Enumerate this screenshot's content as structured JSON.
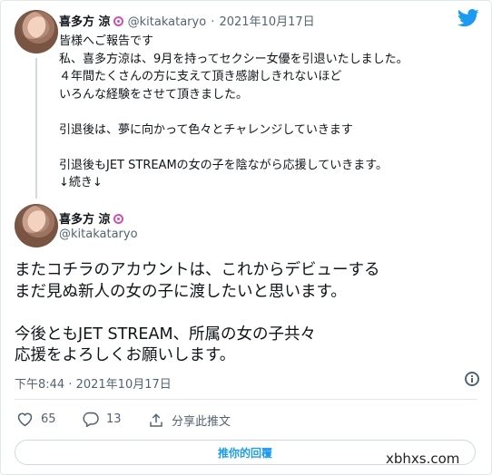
{
  "tweet1": {
    "display_name": "喜多方 涼",
    "handle": "@kitakataryo",
    "separator": "·",
    "date": "2021年10月17日",
    "text": "皆様へご報告です\n私、喜多方涼は、9月を持ってセクシー女優を引退いたしました。\n４年間たくさんの方に支えて頂き感謝しきれないほど\nいろんな経験をさせて頂きました。\n\n引退後は、夢に向かって色々とチャレンジしていきます\n\n引退後もJET STREAMの女の子を陰ながら応援していきます。\n↓続き↓"
  },
  "tweet2": {
    "display_name": "喜多方 涼",
    "handle": "@kitakataryo",
    "text": "またコチラのアカウントは、これからデビューする\nまだ見ぬ新人の女の子に渡したいと思います。\n\n今後ともJET STREAM、所属の女の子共々\n応援をよろしくお願いします。",
    "timestamp": "下午8:44 · 2021年10月17日"
  },
  "actions": {
    "likes": "65",
    "replies": "13",
    "share_label": "分享此推文"
  },
  "reply_button": "推你的回覆",
  "watermark": "xbhxs.com",
  "icons": {
    "logo": "twitter-bird-icon",
    "info": "info-icon",
    "like": "heart-icon",
    "reply": "comment-icon",
    "share": "share-icon",
    "badge": "verified-style-badge-icon"
  },
  "colors": {
    "accent": "#1d9bf0",
    "muted": "#536471",
    "badge": "#d04fb2"
  }
}
